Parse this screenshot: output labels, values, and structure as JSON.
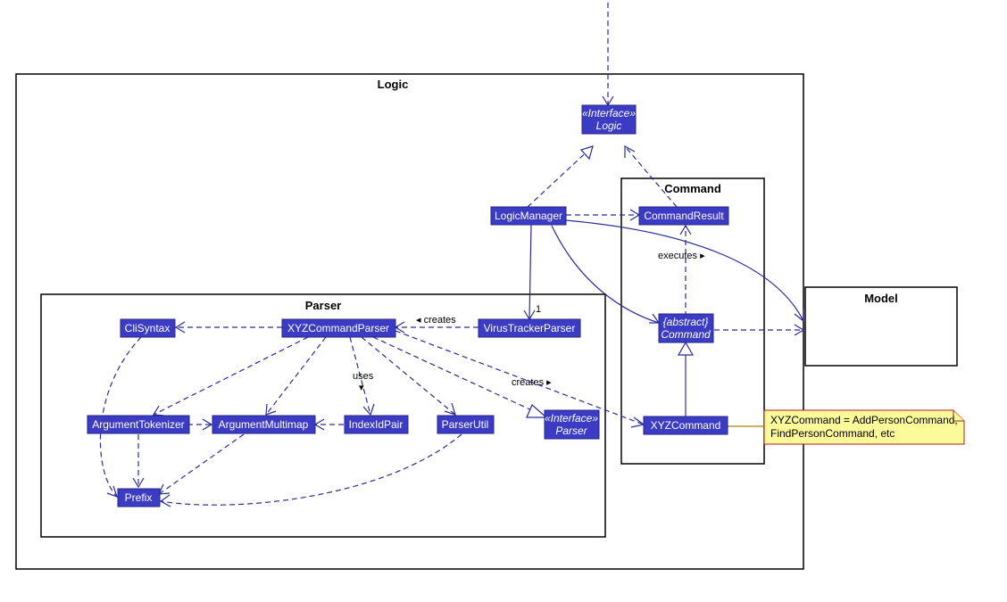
{
  "diagram": {
    "frames": {
      "logic": "Logic",
      "parser": "Parser",
      "command": "Command",
      "model": "Model"
    },
    "nodes": {
      "interfaceLogic": {
        "stereotype": "«Interface»",
        "name": "Logic"
      },
      "logicManager": "LogicManager",
      "commandResult": "CommandResult",
      "abstractCommand": {
        "stereotype": "{abstract}",
        "name": "Command"
      },
      "xyzCommand": "XYZCommand",
      "virusTrackerParser": "VirusTrackerParser",
      "xyzCommandParser": "XYZCommandParser",
      "cliSyntax": "CliSyntax",
      "argumentTokenizer": "ArgumentTokenizer",
      "argumentMultimap": "ArgumentMultimap",
      "indexIdPair": "IndexIdPair",
      "parserUtil": "ParserUtil",
      "interfaceParser": {
        "stereotype": "«Interface»",
        "name": "Parser"
      },
      "prefix": "Prefix"
    },
    "labels": {
      "creates1": "creates",
      "uses": "uses",
      "creates2": "creates",
      "executes": "executes",
      "mult1": "1"
    },
    "note": {
      "line1": "XYZCommand = AddPersonCommand,",
      "line2": "FindPersonCommand, etc"
    }
  }
}
